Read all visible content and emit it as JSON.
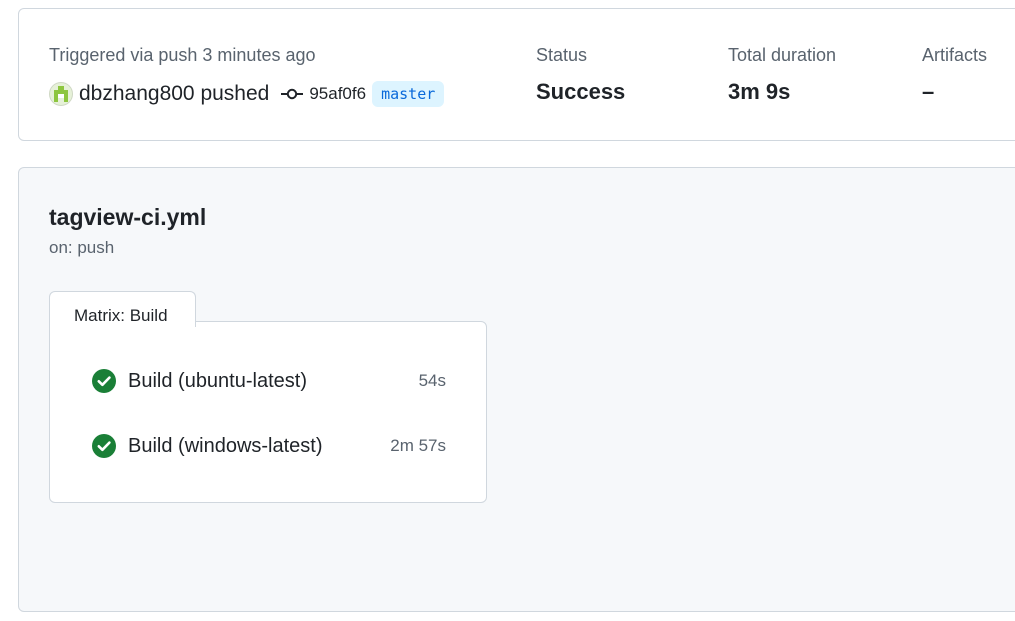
{
  "summary": {
    "trigger_text": "Triggered via push 3 minutes ago",
    "pusher": "dbzhang800 pushed",
    "commit_sha": "95af0f6",
    "branch": "master",
    "status_label": "Status",
    "status_value": "Success",
    "duration_label": "Total duration",
    "duration_value": "3m 9s",
    "artifacts_label": "Artifacts",
    "artifacts_value": "–"
  },
  "workflow": {
    "file_name": "tagview-ci.yml",
    "trigger": "on: push",
    "matrix_label": "Matrix: Build",
    "jobs": [
      {
        "name": "Build (ubuntu-latest)",
        "duration": "54s",
        "status": "success"
      },
      {
        "name": "Build (windows-latest)",
        "duration": "2m 57s",
        "status": "success"
      }
    ]
  },
  "colors": {
    "success": "#1a7f37",
    "branch_text": "#0969da",
    "branch_bg": "#ddf4ff",
    "muted_text": "#59636e",
    "border": "#d0d7de"
  },
  "icons": {
    "avatar": "identicon-avatar",
    "commit": "git-commit-icon",
    "job_status": "check-circle-fill-icon"
  }
}
